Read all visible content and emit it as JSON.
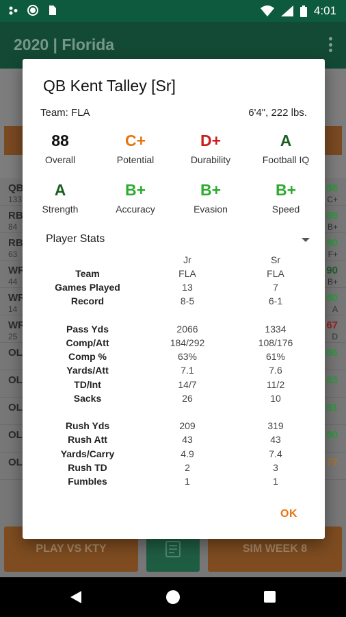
{
  "status_bar": {
    "time": "4:01"
  },
  "app_bar": {
    "title": "2020 | Florida"
  },
  "background": {
    "rows": [
      {
        "pos": "QB",
        "sub": "133",
        "rating": "88",
        "grade": "C+",
        "color": "#2e9a3e"
      },
      {
        "pos": "RB",
        "sub": "84",
        "rating": "89",
        "grade": "B+",
        "color": "#2e9a3e"
      },
      {
        "pos": "RB",
        "sub": "63",
        "rating": "80",
        "grade": "F+",
        "color": "#2e9a3e"
      },
      {
        "pos": "WR",
        "sub": "44",
        "rating": "90",
        "grade": "B+",
        "color": "#1f5d2a"
      },
      {
        "pos": "WR",
        "sub": "14",
        "rating": "80",
        "grade": "A",
        "color": "#2e9a3e"
      },
      {
        "pos": "WR",
        "sub": "25",
        "rating": "67",
        "grade": "D",
        "color": "#9a2020"
      },
      {
        "pos": "OL",
        "sub": "",
        "rating": "86",
        "grade": "",
        "color": "#2e9a3e"
      },
      {
        "pos": "OL",
        "sub": "",
        "rating": "83",
        "grade": "",
        "color": "#2e9a3e"
      },
      {
        "pos": "OL",
        "sub": "",
        "rating": "81",
        "grade": "",
        "color": "#2e9a3e"
      },
      {
        "pos": "OL",
        "sub": "",
        "rating": "80",
        "grade": "",
        "color": "#2e9a3e"
      },
      {
        "pos": "OL",
        "sub": "",
        "rating": "77",
        "grade": "",
        "color": "#b5761a"
      }
    ],
    "buttons": {
      "play": "PLAY VS KTY",
      "sim": "SIM WEEK 8"
    }
  },
  "dialog": {
    "title": "QB Kent Talley [Sr]",
    "team": "Team: FLA",
    "size": "6'4\", 222 lbs.",
    "grades": [
      {
        "value": "88",
        "label": "Overall",
        "color": "#111111"
      },
      {
        "value": "C+",
        "label": "Potential",
        "color": "#e8730c"
      },
      {
        "value": "D+",
        "label": "Durability",
        "color": "#cc1a1a"
      },
      {
        "value": "A",
        "label": "Football IQ",
        "color": "#1b5e20"
      },
      {
        "value": "A",
        "label": "Strength",
        "color": "#1b5e20"
      },
      {
        "value": "B+",
        "label": "Accuracy",
        "color": "#2eaa2e"
      },
      {
        "value": "B+",
        "label": "Evasion",
        "color": "#2eaa2e"
      },
      {
        "value": "B+",
        "label": "Speed",
        "color": "#2eaa2e"
      }
    ],
    "stats_select": "Player Stats",
    "stats": {
      "columns": [
        "Jr",
        "Sr"
      ],
      "rows": [
        {
          "label": "Team",
          "jr": "FLA",
          "sr": "FLA"
        },
        {
          "label": "Games Played",
          "jr": "13",
          "sr": "7"
        },
        {
          "label": "Record",
          "jr": "8-5",
          "sr": "6-1"
        },
        {
          "label": "",
          "jr": "",
          "sr": ""
        },
        {
          "label": "Pass Yds",
          "jr": "2066",
          "sr": "1334"
        },
        {
          "label": "Comp/Att",
          "jr": "184/292",
          "sr": "108/176"
        },
        {
          "label": "Comp %",
          "jr": "63%",
          "sr": "61%"
        },
        {
          "label": "Yards/Att",
          "jr": "7.1",
          "sr": "7.6"
        },
        {
          "label": "TD/Int",
          "jr": "14/7",
          "sr": "11/2"
        },
        {
          "label": "Sacks",
          "jr": "26",
          "sr": "10"
        },
        {
          "label": "",
          "jr": "",
          "sr": ""
        },
        {
          "label": "Rush Yds",
          "jr": "209",
          "sr": "319"
        },
        {
          "label": "Rush Att",
          "jr": "43",
          "sr": "43"
        },
        {
          "label": "Yards/Carry",
          "jr": "4.9",
          "sr": "7.4"
        },
        {
          "label": "Rush TD",
          "jr": "2",
          "sr": "3"
        },
        {
          "label": "Fumbles",
          "jr": "1",
          "sr": "1"
        }
      ]
    },
    "ok_label": "OK"
  }
}
